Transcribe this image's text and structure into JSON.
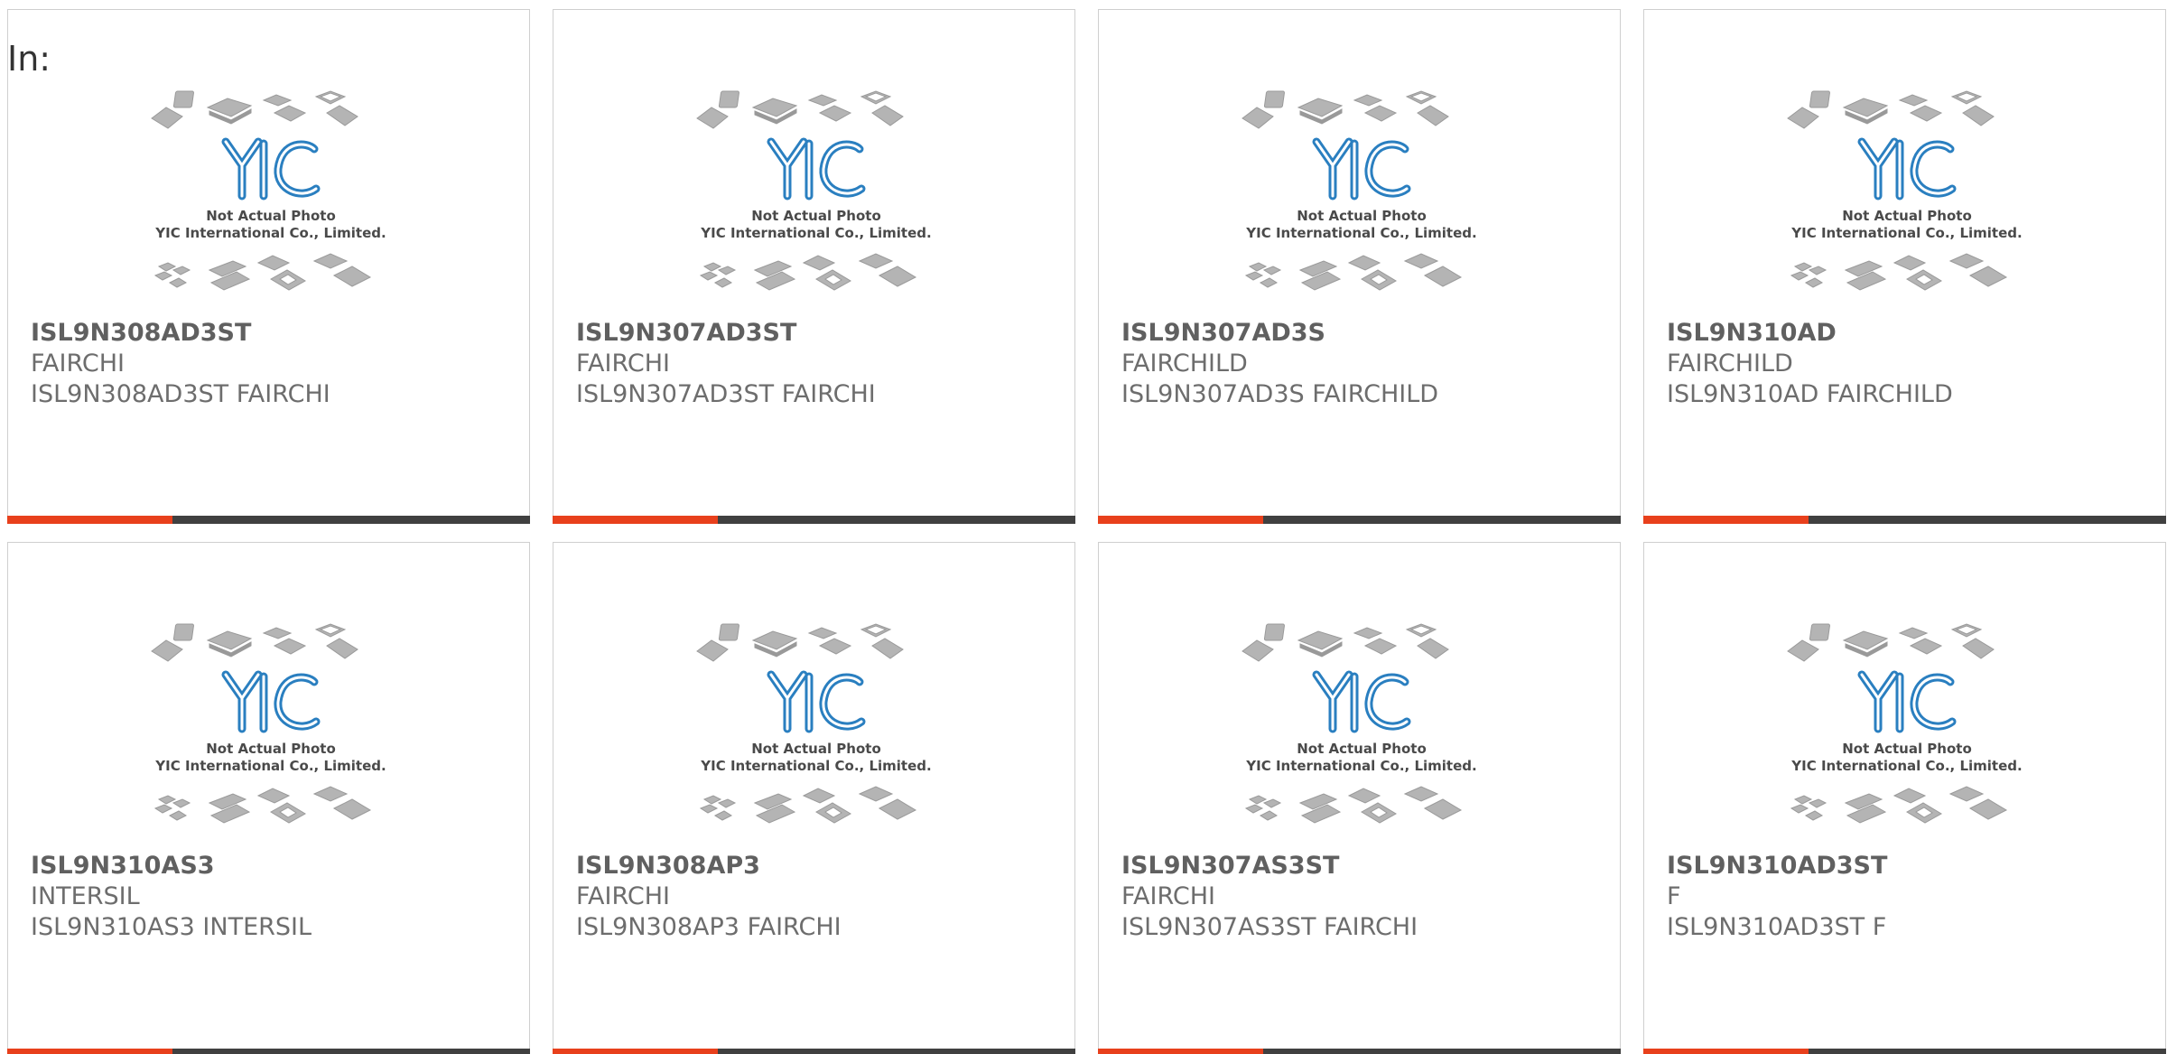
{
  "page": {
    "label": "In:"
  },
  "theme": {
    "accent": "#e8401c",
    "bar_dark": "#404040",
    "logo_blue": "#2a7fc0"
  },
  "placeholder_image": {
    "icon": "chip-placeholder-icon",
    "logo_text": "YIC",
    "caption_line1": "Not Actual Photo",
    "caption_line2": "YIC International Co., Limited."
  },
  "products": [
    {
      "part": "ISL9N308AD3ST",
      "maker": "FAIRCHI",
      "desc": "ISL9N308AD3ST FAIRCHI"
    },
    {
      "part": "ISL9N307AD3ST",
      "maker": "FAIRCHI",
      "desc": "ISL9N307AD3ST FAIRCHI"
    },
    {
      "part": "ISL9N307AD3S",
      "maker": "FAIRCHILD",
      "desc": "ISL9N307AD3S FAIRCHILD"
    },
    {
      "part": "ISL9N310AD",
      "maker": "FAIRCHILD",
      "desc": "ISL9N310AD FAIRCHILD"
    },
    {
      "part": "ISL9N310AS3",
      "maker": "INTERSIL",
      "desc": "ISL9N310AS3 INTERSIL"
    },
    {
      "part": "ISL9N308AP3",
      "maker": "FAIRCHI",
      "desc": "ISL9N308AP3 FAIRCHI"
    },
    {
      "part": "ISL9N307AS3ST",
      "maker": "FAIRCHI",
      "desc": "ISL9N307AS3ST FAIRCHI"
    },
    {
      "part": "ISL9N310AD3ST",
      "maker": "F",
      "desc": "ISL9N310AD3ST F"
    }
  ]
}
